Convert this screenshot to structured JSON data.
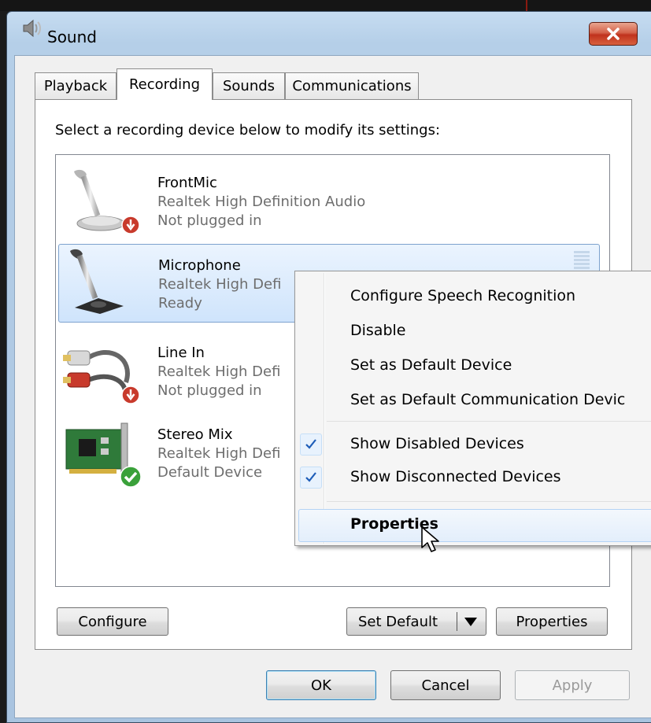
{
  "window": {
    "title": "Sound",
    "close_label": "X"
  },
  "tabs": [
    {
      "label": "Playback"
    },
    {
      "label": "Recording"
    },
    {
      "label": "Sounds"
    },
    {
      "label": "Communications"
    }
  ],
  "instruction": "Select a recording device below to modify its settings:",
  "devices": [
    {
      "name": "FrontMic",
      "driver": "Realtek High Definition Audio",
      "status": "Not plugged in",
      "icon": "microphone-icon",
      "badge": "unplugged-badge-icon"
    },
    {
      "name": "Microphone",
      "driver": "Realtek High Defi",
      "status": "Ready",
      "icon": "microphone-icon",
      "selected": true
    },
    {
      "name": "Line In",
      "driver": "Realtek High Defi",
      "status": "Not plugged in",
      "icon": "rca-cable-icon",
      "badge": "unplugged-badge-icon"
    },
    {
      "name": "Stereo Mix",
      "driver": "Realtek High Defi",
      "status": "Default Device",
      "icon": "sound-card-icon",
      "badge": "default-check-icon"
    }
  ],
  "context_menu": {
    "items": [
      {
        "label": "Configure Speech Recognition"
      },
      {
        "label": "Disable"
      },
      {
        "label": "Set as Default Device"
      },
      {
        "label": "Set as Default Communication Devic"
      },
      {
        "label": "Show Disabled Devices",
        "checked": true
      },
      {
        "label": "Show Disconnected Devices",
        "checked": true
      },
      {
        "label": "Properties",
        "bold": true,
        "hovered": true
      }
    ]
  },
  "buttons": {
    "configure": "Configure",
    "set_default": "Set Default",
    "properties": "Properties",
    "ok": "OK",
    "cancel": "Cancel",
    "apply": "Apply"
  },
  "colors": {
    "selection": "#cfe4fc",
    "close_button": "#c0321c",
    "check": "#1e5db8"
  }
}
